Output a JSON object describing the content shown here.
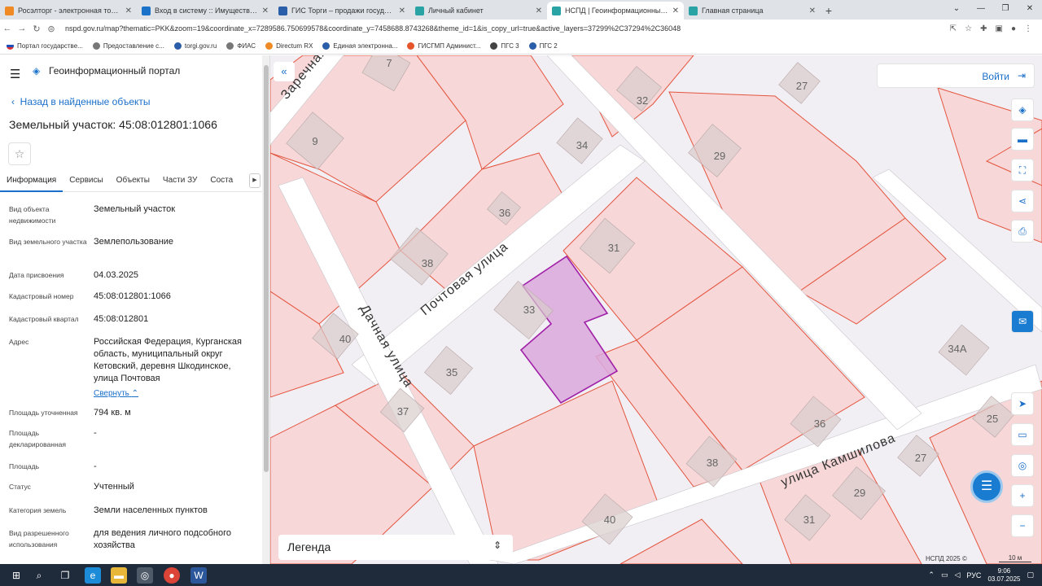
{
  "browser": {
    "tabs": [
      {
        "title": "Росэлторг - электронная торговая",
        "color": "#f08a24"
      },
      {
        "title": "Вход в систему :: Имущественн",
        "color": "#1a73c9"
      },
      {
        "title": "ГИС Торги – продажи государс",
        "color": "#2a5ea8"
      },
      {
        "title": "Личный кабинет",
        "color": "#29a3a3"
      },
      {
        "title": "НСПД | Геоинформационный п",
        "color": "#29a3a3"
      },
      {
        "title": "Главная страница",
        "color": "#29a3a3"
      }
    ],
    "url": "nspd.gov.ru/map?thematic=PKK&zoom=19&coordinate_x=7289586.750699578&coordinate_y=7458688.8743268&theme_id=1&is_copy_url=true&active_layers=37299%2C37294%2C36048",
    "bookmarks": [
      "Портал государстве...",
      "Предоставление с...",
      "torgi.gov.ru",
      "ФИАС",
      "Directum RX",
      "Единая электронна...",
      "ГИСГМП Админист...",
      "ПГС 3",
      "ПГС 2"
    ]
  },
  "panel": {
    "portal_name": "Геоинформационный портал",
    "back_link": "Назад в найденные объекты",
    "title": "Земельный участок: 45:08:012801:1066",
    "tabs": [
      "Информация",
      "Сервисы",
      "Объекты",
      "Части ЗУ",
      "Соста"
    ],
    "attributes": [
      {
        "label": "Вид объекта недвижимости",
        "value": "Земельный участок"
      },
      {
        "label": "Вид земельного участка",
        "value": "Землепользование"
      },
      {
        "label": "Дата присвоения",
        "value": "04.03.2025"
      },
      {
        "label": "Кадастровый номер",
        "value": "45:08:012801:1066"
      },
      {
        "label": "Кадастровый квартал",
        "value": "45:08:012801"
      },
      {
        "label": "Адрес",
        "value": "Российская Федерация, Курганская область, муниципальный округ Кетовский, деревня Шкодинское, улица Почтовая"
      },
      {
        "label": "Площадь уточненная",
        "value": "794 кв. м"
      },
      {
        "label": "Площадь декларированная",
        "value": "-"
      },
      {
        "label": "Площадь",
        "value": "-"
      },
      {
        "label": "Статус",
        "value": "Учтенный"
      },
      {
        "label": "Категория земель",
        "value": "Земли населенных пунктов"
      },
      {
        "label": "Вид разрешенного использования",
        "value": "для ведения личного подсобного хозяйства"
      }
    ],
    "fold_label": "Свернуть"
  },
  "map": {
    "login_label": "Войти",
    "legend_label": "Легенда",
    "copyright": "НСПД 2025 ©",
    "scale_label": "10 м",
    "streets": [
      "Почтовая улица",
      "Дачная улица",
      "улица Камшилова",
      "Заречная"
    ],
    "house_numbers": [
      "7",
      "32",
      "27",
      "9",
      "34",
      "29",
      "36",
      "31",
      "38",
      "33",
      "40",
      "35",
      "34А",
      "37",
      "36",
      "25",
      "38",
      "27",
      "40",
      "31",
      "29"
    ],
    "colors": {
      "parcel_fill": "#f7d7d7",
      "parcel_line": "#e4553f",
      "selected_fill": "#dba8dc",
      "selected_line": "#a020a8",
      "road": "#ffffff",
      "accent": "#1a6fc9"
    }
  },
  "taskbar": {
    "lang": "РУС",
    "time": "9:06",
    "date": "03.07.2025"
  }
}
